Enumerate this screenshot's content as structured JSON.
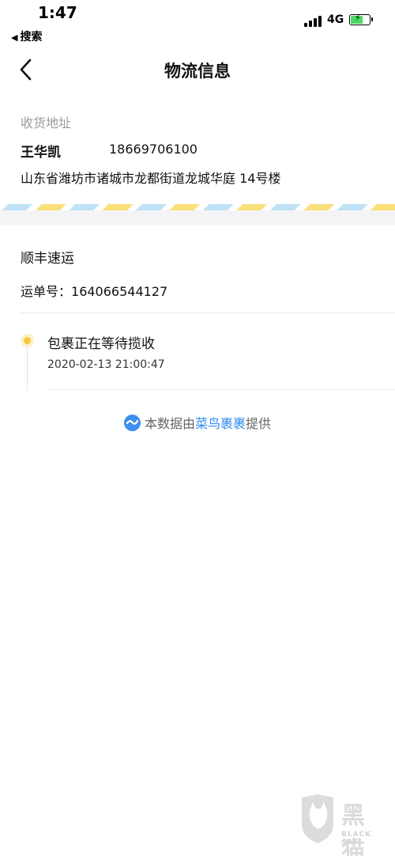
{
  "status_bar": {
    "time": "1:47",
    "back_app_label": "搜索",
    "network": "4G"
  },
  "nav": {
    "title": "物流信息"
  },
  "address": {
    "label": "收货地址",
    "name": "王华凯",
    "phone": "18669706100",
    "detail": "山东省潍坊市诸城市龙都街道龙城华庭 14号楼"
  },
  "shipment": {
    "courier": "顺丰速运",
    "waybill_label": "运单号：",
    "waybill_number": "164066544127"
  },
  "timeline": [
    {
      "text": "包裹正在等待揽收",
      "time": "2020-02-13 21:00:47"
    }
  ],
  "source": {
    "prefix": "本数据由",
    "brand": "菜鸟裹裹",
    "suffix": "提供"
  },
  "watermark": {
    "cn": "黑猫",
    "en": "BLACK CAT"
  },
  "colors": {
    "accent_blue": "#2f8cf0",
    "timeline_dot": "#f7c840",
    "stripe_yellow": "#fbe07a",
    "stripe_blue": "#bfe2f7"
  }
}
